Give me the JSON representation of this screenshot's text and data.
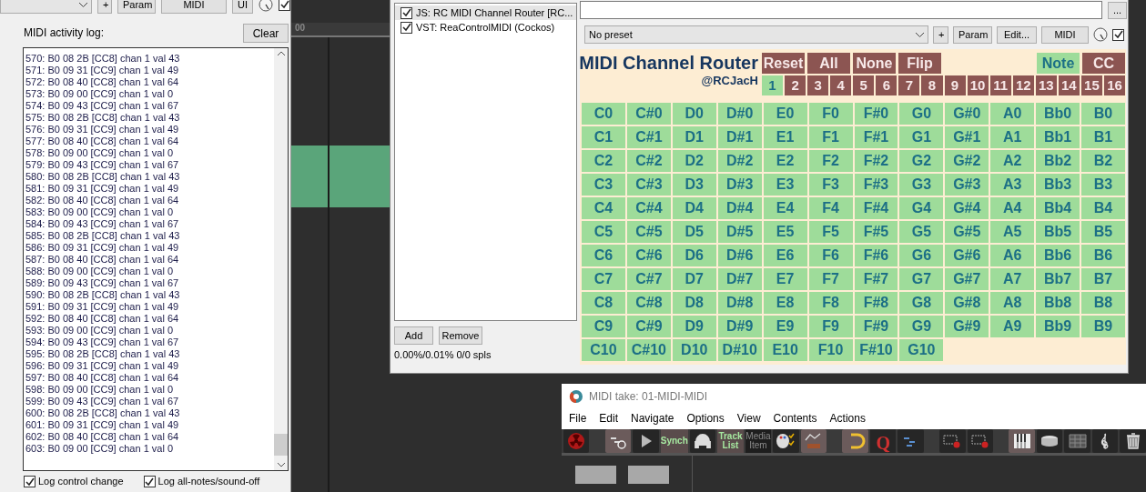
{
  "left_panel": {
    "top_buttons": [
      "+",
      "Param",
      "MIDI",
      "UI"
    ],
    "enabled_checked": true,
    "log_label": "MIDI activity log:",
    "clear_button": "Clear",
    "log_lines": [
      "570: B0 08 2B [CC8] chan 1 val 43",
      "571: B0 09 31 [CC9] chan 1 val 49",
      "572: B0 08 40 [CC8] chan 1 val 64",
      "573: B0 09 00 [CC9] chan 1 val 0",
      "574: B0 09 43 [CC9] chan 1 val 67",
      "575: B0 08 2B [CC8] chan 1 val 43",
      "576: B0 09 31 [CC9] chan 1 val 49",
      "577: B0 08 40 [CC8] chan 1 val 64",
      "578: B0 09 00 [CC9] chan 1 val 0",
      "579: B0 09 43 [CC9] chan 1 val 67",
      "580: B0 08 2B [CC8] chan 1 val 43",
      "581: B0 09 31 [CC9] chan 1 val 49",
      "582: B0 08 40 [CC8] chan 1 val 64",
      "583: B0 09 00 [CC9] chan 1 val 0",
      "584: B0 09 43 [CC9] chan 1 val 67",
      "585: B0 08 2B [CC8] chan 1 val 43",
      "586: B0 09 31 [CC9] chan 1 val 49",
      "587: B0 08 40 [CC8] chan 1 val 64",
      "588: B0 09 00 [CC9] chan 1 val 0",
      "589: B0 09 43 [CC9] chan 1 val 67",
      "590: B0 08 2B [CC8] chan 1 val 43",
      "591: B0 09 31 [CC9] chan 1 val 49",
      "592: B0 08 40 [CC8] chan 1 val 64",
      "593: B0 09 00 [CC9] chan 1 val 0",
      "594: B0 09 43 [CC9] chan 1 val 67",
      "595: B0 08 2B [CC8] chan 1 val 43",
      "596: B0 09 31 [CC9] chan 1 val 49",
      "597: B0 08 40 [CC8] chan 1 val 64",
      "598: B0 09 00 [CC9] chan 1 val 0",
      "599: B0 09 43 [CC9] chan 1 val 67",
      "600: B0 08 2B [CC8] chan 1 val 43",
      "601: B0 09 31 [CC9] chan 1 val 49",
      "602: B0 08 40 [CC8] chan 1 val 64",
      "603: B0 09 00 [CC9] chan 1 val 0"
    ],
    "options": [
      {
        "label": "Log control change",
        "checked": true
      },
      {
        "label": "Log all-notes/sound-off",
        "checked": true
      }
    ]
  },
  "timeline": {
    "ruler_label": "00"
  },
  "fx_window": {
    "fx_list": [
      {
        "label": "JS: RC MIDI Channel Router [RC...",
        "checked": true,
        "selected": true
      },
      {
        "label": "VST: ReaControlMIDI (Cockos)",
        "checked": true,
        "selected": false
      }
    ],
    "list_buttons": [
      "Add",
      "Remove"
    ],
    "cpu": "0.00%/0.01% 0/0 spls",
    "more_button": "...",
    "preset": "No preset",
    "preset_buttons": [
      "+",
      "Param",
      "Edit...",
      "MIDI"
    ],
    "bypass_checked": true,
    "router": {
      "title": "MIDI Channel Router",
      "author": "@RCJacH",
      "actions": [
        "Reset",
        "All",
        "None",
        "Flip"
      ],
      "modes": [
        {
          "label": "Note",
          "selected": true
        },
        {
          "label": "CC",
          "selected": false
        }
      ],
      "channels": [
        {
          "label": "1",
          "selected": true
        },
        {
          "label": "2",
          "selected": false
        },
        {
          "label": "3",
          "selected": false
        },
        {
          "label": "4",
          "selected": false
        },
        {
          "label": "5",
          "selected": false
        },
        {
          "label": "6",
          "selected": false
        },
        {
          "label": "7",
          "selected": false
        },
        {
          "label": "8",
          "selected": false
        },
        {
          "label": "9",
          "selected": false
        },
        {
          "label": "10",
          "selected": false
        },
        {
          "label": "11",
          "selected": false
        },
        {
          "label": "12",
          "selected": false
        },
        {
          "label": "13",
          "selected": false
        },
        {
          "label": "14",
          "selected": false
        },
        {
          "label": "15",
          "selected": false
        },
        {
          "label": "16",
          "selected": false
        }
      ],
      "notes": [
        [
          "C0",
          "C#0",
          "D0",
          "D#0",
          "E0",
          "F0",
          "F#0",
          "G0",
          "G#0",
          "A0",
          "Bb0",
          "B0"
        ],
        [
          "C1",
          "C#1",
          "D1",
          "D#1",
          "E1",
          "F1",
          "F#1",
          "G1",
          "G#1",
          "A1",
          "Bb1",
          "B1"
        ],
        [
          "C2",
          "C#2",
          "D2",
          "D#2",
          "E2",
          "F2",
          "F#2",
          "G2",
          "G#2",
          "A2",
          "Bb2",
          "B2"
        ],
        [
          "C3",
          "C#3",
          "D3",
          "D#3",
          "E3",
          "F3",
          "F#3",
          "G3",
          "G#3",
          "A3",
          "Bb3",
          "B3"
        ],
        [
          "C4",
          "C#4",
          "D4",
          "D#4",
          "E4",
          "F4",
          "F#4",
          "G4",
          "G#4",
          "A4",
          "Bb4",
          "B4"
        ],
        [
          "C5",
          "C#5",
          "D5",
          "D#5",
          "E5",
          "F5",
          "F#5",
          "G5",
          "G#5",
          "A5",
          "Bb5",
          "B5"
        ],
        [
          "C6",
          "C#6",
          "D6",
          "D#6",
          "E6",
          "F6",
          "F#6",
          "G6",
          "G#6",
          "A6",
          "Bb6",
          "B6"
        ],
        [
          "C7",
          "C#7",
          "D7",
          "D#7",
          "E7",
          "F7",
          "F#7",
          "G7",
          "G#7",
          "A7",
          "Bb7",
          "B7"
        ],
        [
          "C8",
          "C#8",
          "D8",
          "D#8",
          "E8",
          "F8",
          "F#8",
          "G8",
          "G#8",
          "A8",
          "Bb8",
          "B8"
        ],
        [
          "C9",
          "C#9",
          "D9",
          "D#9",
          "E9",
          "F9",
          "F#9",
          "G9",
          "G#9",
          "A9",
          "Bb9",
          "B9"
        ],
        [
          "C10",
          "C#10",
          "D10",
          "D#10",
          "E10",
          "F10",
          "F#10",
          "G10"
        ]
      ]
    }
  },
  "midi_editor": {
    "title": "MIDI take: 01-MIDI-MIDI",
    "menu": [
      "File",
      "Edit",
      "Navigate",
      "Options",
      "View",
      "Contents",
      "Actions"
    ],
    "toolbar_texts": [
      {
        "kind": "text",
        "label": "Synch",
        "on": true
      },
      {
        "kind": "text",
        "label": "Track List",
        "on": true
      },
      {
        "kind": "text",
        "label": "Media Item",
        "on": false
      },
      {
        "kind": "letter",
        "label": "Q"
      }
    ]
  }
}
